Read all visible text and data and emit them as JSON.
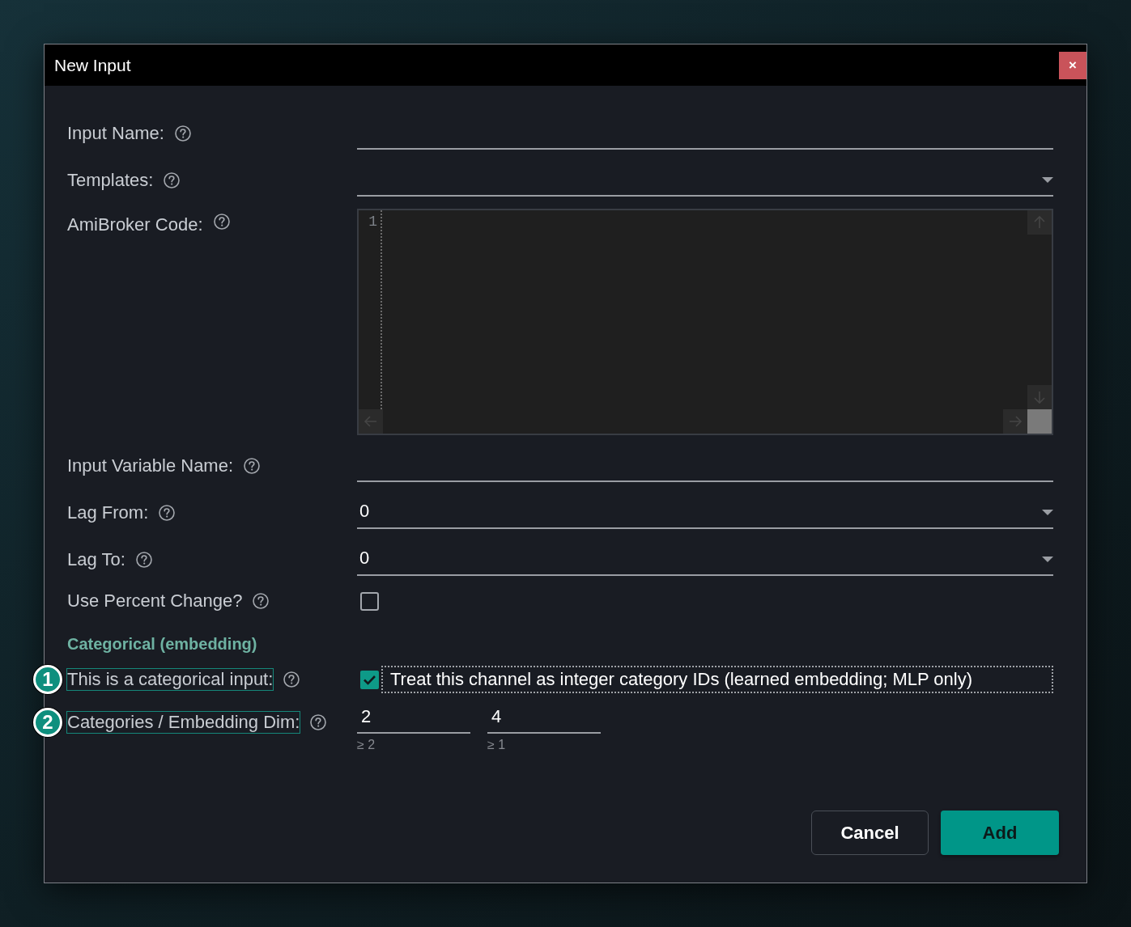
{
  "window": {
    "title": "New Input",
    "close_label": "×"
  },
  "form": {
    "rows": [
      {
        "kind": "text",
        "label": "Input Name:",
        "highlighted": false
      },
      {
        "kind": "dropdown",
        "label": "Templates:",
        "highlighted": false
      },
      {
        "kind": "code",
        "label": "AmiBroker Code:",
        "highlighted": false,
        "line_numbers": [
          "1"
        ]
      },
      {
        "kind": "text",
        "label": "Input Variable Name:",
        "highlighted": false
      },
      {
        "kind": "dropdown",
        "label": "Lag From:",
        "highlighted": false,
        "value": "0"
      },
      {
        "kind": "dropdown",
        "label": "Lag To:",
        "highlighted": false,
        "value": "0"
      },
      {
        "kind": "checkbox",
        "label": "Use Percent Change?",
        "highlighted": false,
        "checked": false
      },
      {
        "kind": "section",
        "title": "Categorical (embedding)"
      },
      {
        "kind": "checkbox",
        "label": "This is a categorical input:",
        "marker": "1",
        "highlighted": true,
        "checked": true,
        "focused": true,
        "text": "Treat this channel as integer category IDs (learned embedding; MLP only)"
      },
      {
        "kind": "number_pair",
        "label": "Categories / Embedding Dim:",
        "marker": "2",
        "highlighted": true,
        "fields": [
          {
            "value": "2",
            "hint": "≥ 2"
          },
          {
            "value": "4",
            "hint": "≥ 1"
          }
        ]
      }
    ]
  },
  "buttons": [
    {
      "label": "Cancel",
      "kind": "secondary"
    },
    {
      "label": "Add",
      "kind": "primary"
    }
  ]
}
